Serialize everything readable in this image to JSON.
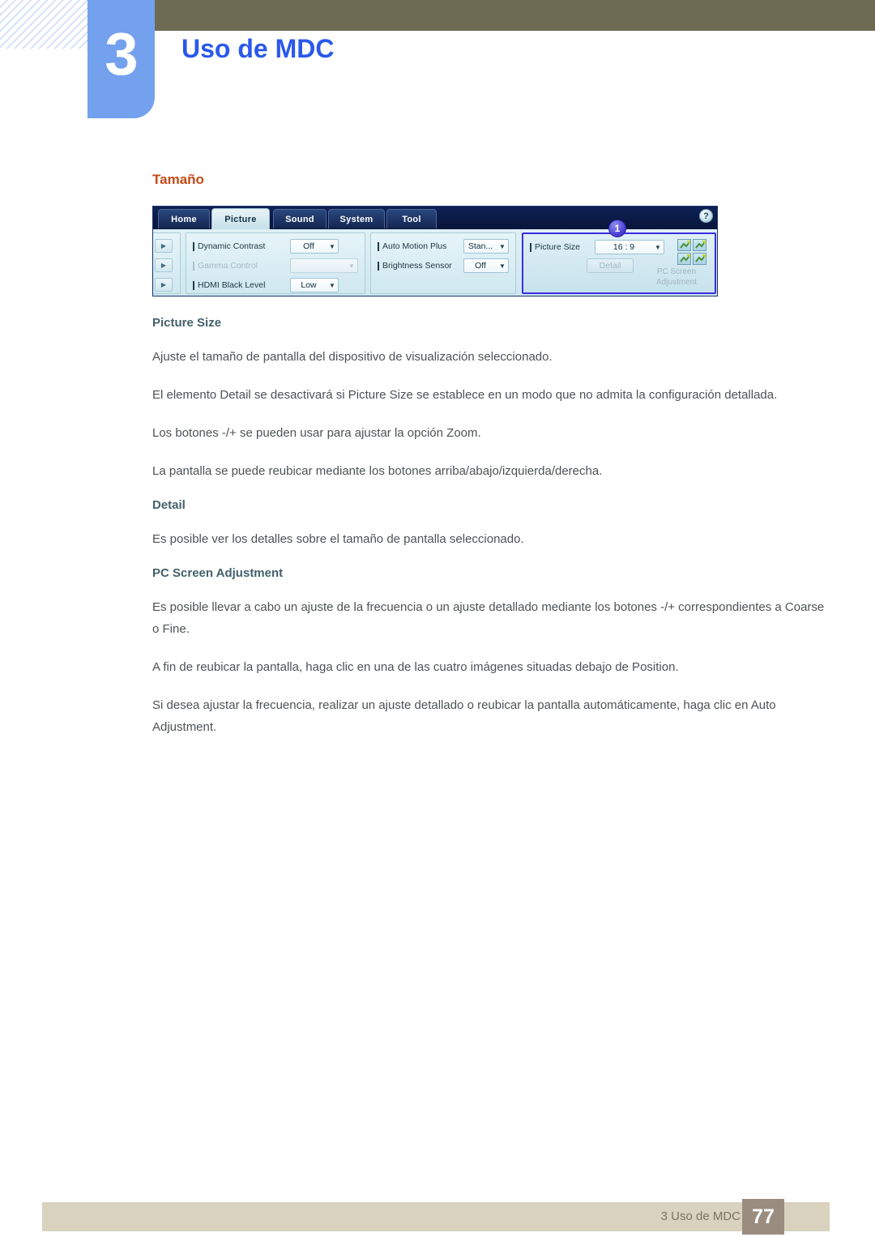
{
  "header": {
    "chapter_number": "3",
    "chapter_title": "Uso de MDC"
  },
  "content": {
    "section_title": "Tamaño",
    "blocks": [
      {
        "type": "head",
        "text": "Picture Size"
      },
      {
        "type": "para",
        "text": "Ajuste el tamaño de pantalla del dispositivo de visualización seleccionado."
      },
      {
        "type": "para",
        "text": "El elemento Detail se desactivará si Picture Size se establece en un modo que no admita la configuración detallada."
      },
      {
        "type": "para",
        "text": "Los botones -/+ se pueden usar para ajustar la opción Zoom."
      },
      {
        "type": "para",
        "text": "La pantalla se puede reubicar mediante los botones arriba/abajo/izquierda/derecha."
      },
      {
        "type": "head",
        "text": "Detail"
      },
      {
        "type": "para",
        "text": "Es posible ver los detalles sobre el tamaño de pantalla seleccionado."
      },
      {
        "type": "head",
        "text": "PC Screen Adjustment"
      },
      {
        "type": "para",
        "text": "Es posible llevar a cabo un ajuste de la frecuencia o un ajuste detallado mediante los botones -/+ correspondientes a Coarse o Fine."
      },
      {
        "type": "para",
        "text": "A fin de reubicar la pantalla, haga clic en una de las cuatro imágenes situadas debajo de Position."
      },
      {
        "type": "para",
        "text": "Si desea ajustar la frecuencia, realizar un ajuste detallado o reubicar la pantalla automáticamente, haga clic en Auto Adjustment."
      }
    ]
  },
  "mdc": {
    "tabs": [
      {
        "label": "Home",
        "active": false
      },
      {
        "label": "Picture",
        "active": true
      },
      {
        "label": "Sound",
        "active": false
      },
      {
        "label": "System",
        "active": false
      },
      {
        "label": "Tool",
        "active": false
      }
    ],
    "help_label": "?",
    "callout_badge": "1",
    "picture_panel": {
      "rows": [
        {
          "label": "Dynamic Contrast",
          "value": "Off",
          "disabled": false
        },
        {
          "label": "Gamma Control",
          "value": "",
          "disabled": true
        },
        {
          "label": "HDMI Black Level",
          "value": "Low",
          "disabled": false
        }
      ]
    },
    "motion_panel": {
      "rows": [
        {
          "label": "Auto Motion Plus",
          "value": "Stan...",
          "disabled": false
        },
        {
          "label": "Brightness Sensor",
          "value": "Off",
          "disabled": false
        }
      ]
    },
    "size_panel": {
      "picture_size_label": "Picture Size",
      "picture_size_value": "16 : 9",
      "detail_button": "Detail",
      "pc_screen_line1": "PC Screen",
      "pc_screen_line2": "Adjustment"
    }
  },
  "footer": {
    "text": "3 Uso de MDC",
    "page_number": "77"
  },
  "colors": {
    "topbar": "#6e6b55",
    "chapter_blue": "#74a1ee",
    "title_blue": "#2a58ea",
    "section_orange": "#c44a17",
    "subhead_slate": "#44606b",
    "body_gray": "#4e5255",
    "footer_beige": "#d8d2be",
    "page_box": "#9b8c80",
    "highlight_border": "#3a2fe0"
  }
}
